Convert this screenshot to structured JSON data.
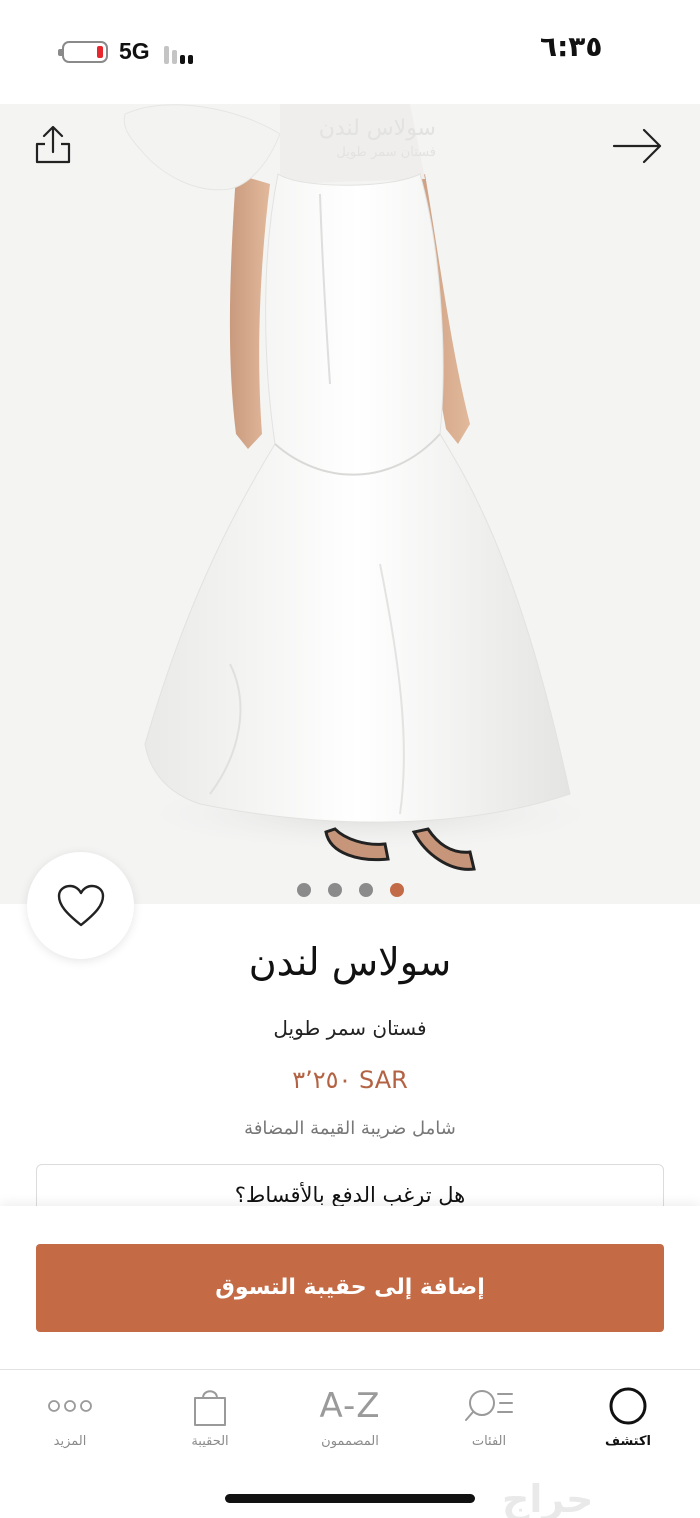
{
  "status_bar": {
    "network": "5G",
    "time": "٦:٣٥"
  },
  "hero": {
    "icons": {
      "share": "share-icon",
      "back": "arrow-right-icon",
      "favorite": "heart-outline-icon"
    },
    "carousel": {
      "count": 4,
      "active_index": 3
    },
    "overlay_brand": "سولاس لندن",
    "overlay_title": "فستان سمر طويل"
  },
  "product": {
    "brand": "سولاس لندن",
    "title": "فستان سمر طويل",
    "price": "SAR ٣٬٢٥٠",
    "tax_note": "شامل ضريبة القيمة المضافة",
    "installments_prompt": "هل ترغب الدفع بالأقساط؟"
  },
  "cta": {
    "add_to_bag": "إضافة إلى حقيبة التسوق"
  },
  "tabbar": {
    "items": [
      {
        "label": "اكتشف",
        "icon": "discover-circle-icon",
        "active": true
      },
      {
        "label": "الفئات",
        "icon": "categories-icon",
        "active": false
      },
      {
        "label": "المصممون",
        "icon": "az-icon",
        "icon_text": "A-Z",
        "active": false
      },
      {
        "label": "الحقيبة",
        "icon": "bag-icon",
        "active": false
      },
      {
        "label": "المزيد",
        "icon": "more-dots-icon",
        "active": false
      }
    ]
  },
  "watermark": "حراج",
  "colors": {
    "accent": "#c46b46",
    "price": "#b36344",
    "battery_low": "#e8262d",
    "dot_inactive": "#8b8b8b"
  }
}
